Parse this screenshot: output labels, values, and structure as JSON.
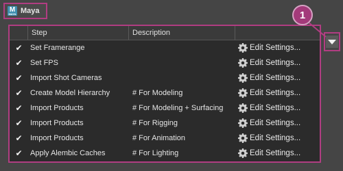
{
  "tab": {
    "logo_letter": "M",
    "logo_sub": "MAYA",
    "label": "Maya"
  },
  "table": {
    "columns": [
      "",
      "Step",
      "Description",
      ""
    ],
    "rows": [
      {
        "checked": true,
        "step": "Set Framerange",
        "description": "",
        "action": "Edit Settings..."
      },
      {
        "checked": true,
        "step": "Set FPS",
        "description": "",
        "action": "Edit Settings..."
      },
      {
        "checked": true,
        "step": "Import Shot Cameras",
        "description": "",
        "action": "Edit Settings..."
      },
      {
        "checked": true,
        "step": "Create Model Hierarchy",
        "description": "# For Modeling",
        "action": "Edit Settings..."
      },
      {
        "checked": true,
        "step": "Import Products",
        "description": "# For Modeling + Surfacing",
        "action": "Edit Settings..."
      },
      {
        "checked": true,
        "step": "Import Products",
        "description": "# For Rigging",
        "action": "Edit Settings..."
      },
      {
        "checked": true,
        "step": "Import Products",
        "description": "# For Animation",
        "action": "Edit Settings..."
      },
      {
        "checked": true,
        "step": "Apply Alembic Caches",
        "description": "# For Lighting",
        "action": "Edit Settings..."
      }
    ]
  },
  "callout": {
    "number": "1"
  },
  "icons": {
    "check": "check-icon",
    "settings": "gear-icon",
    "dropdown": "chevron-down-icon"
  },
  "colors": {
    "highlight": "#b13d82",
    "callout_fill": "#a33a7a",
    "logo": "#3f8fb0"
  }
}
